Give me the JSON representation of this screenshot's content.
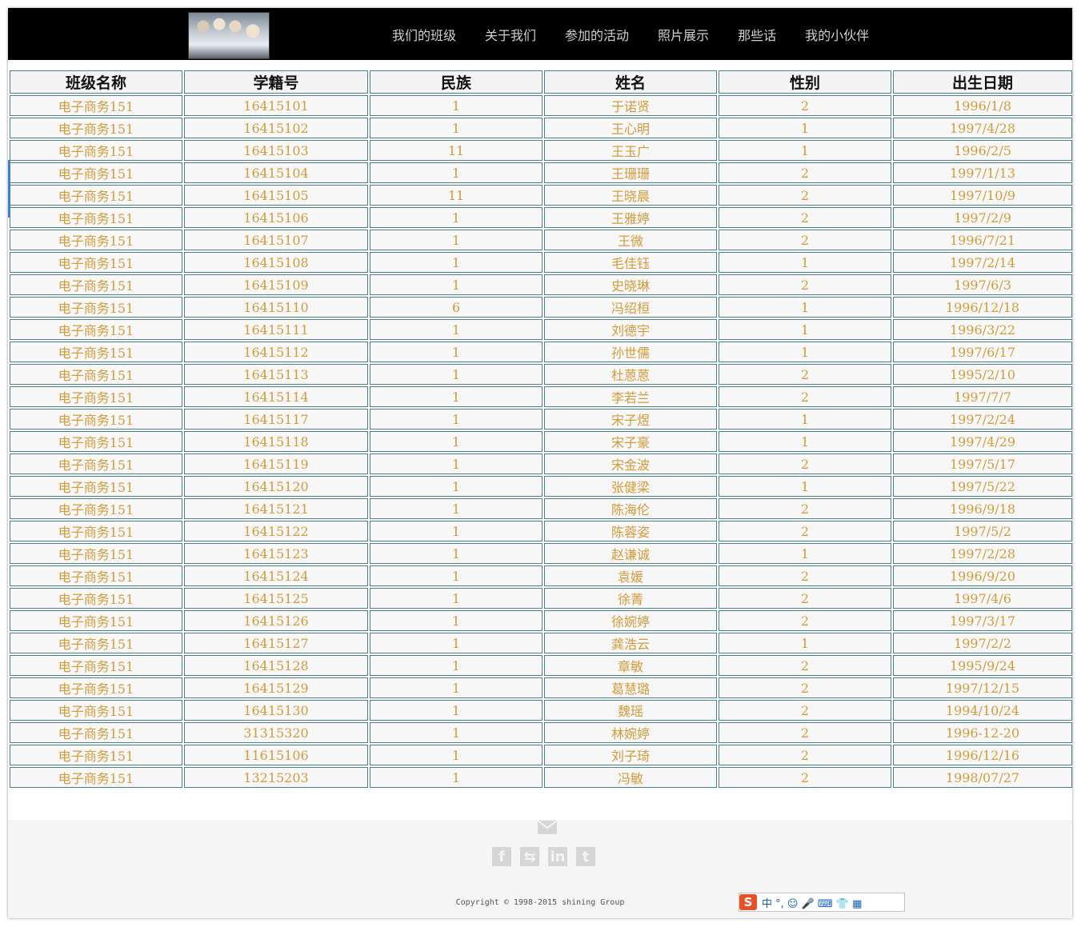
{
  "nav": {
    "items": [
      "我们的班级",
      "关于我们",
      "参加的活动",
      "照片展示",
      "那些话",
      "我的小伙伴"
    ]
  },
  "table": {
    "headers": [
      "班级名称",
      "学籍号",
      "民族",
      "姓名",
      "性别",
      "出生日期"
    ],
    "rows": [
      [
        "电子商务151",
        "16415101",
        "1",
        "于诺贤",
        "2",
        "1996/1/8"
      ],
      [
        "电子商务151",
        "16415102",
        "1",
        "王心明",
        "1",
        "1997/4/28"
      ],
      [
        "电子商务151",
        "16415103",
        "11",
        "王玉广",
        "1",
        "1996/2/5"
      ],
      [
        "电子商务151",
        "16415104",
        "1",
        "王珊珊",
        "2",
        "1997/1/13"
      ],
      [
        "电子商务151",
        "16415105",
        "11",
        "王晓晨",
        "2",
        "1997/10/9"
      ],
      [
        "电子商务151",
        "16415106",
        "1",
        "王雅婷",
        "2",
        "1997/2/9"
      ],
      [
        "电子商务151",
        "16415107",
        "1",
        "王微",
        "2",
        "1996/7/21"
      ],
      [
        "电子商务151",
        "16415108",
        "1",
        "毛佳钰",
        "1",
        "1997/2/14"
      ],
      [
        "电子商务151",
        "16415109",
        "1",
        "史晓琳",
        "2",
        "1997/6/3"
      ],
      [
        "电子商务151",
        "16415110",
        "6",
        "冯绍桓",
        "1",
        "1996/12/18"
      ],
      [
        "电子商务151",
        "16415111",
        "1",
        "刘德宇",
        "1",
        "1996/3/22"
      ],
      [
        "电子商务151",
        "16415112",
        "1",
        "孙世儒",
        "1",
        "1997/6/17"
      ],
      [
        "电子商务151",
        "16415113",
        "1",
        "杜蒽蒽",
        "2",
        "1995/2/10"
      ],
      [
        "电子商务151",
        "16415114",
        "1",
        "李若兰",
        "2",
        "1997/7/7"
      ],
      [
        "电子商务151",
        "16415117",
        "1",
        "宋子煜",
        "1",
        "1997/2/24"
      ],
      [
        "电子商务151",
        "16415118",
        "1",
        "宋子豪",
        "1",
        "1997/4/29"
      ],
      [
        "电子商务151",
        "16415119",
        "1",
        "宋金波",
        "2",
        "1997/5/17"
      ],
      [
        "电子商务151",
        "16415120",
        "1",
        "张健梁",
        "1",
        "1997/5/22"
      ],
      [
        "电子商务151",
        "16415121",
        "1",
        "陈海伦",
        "2",
        "1996/9/18"
      ],
      [
        "电子商务151",
        "16415122",
        "1",
        "陈蓉姿",
        "2",
        "1997/5/2"
      ],
      [
        "电子商务151",
        "16415123",
        "1",
        "赵谦诚",
        "1",
        "1997/2/28"
      ],
      [
        "电子商务151",
        "16415124",
        "1",
        "袁媛",
        "2",
        "1996/9/20"
      ],
      [
        "电子商务151",
        "16415125",
        "1",
        "徐菁",
        "2",
        "1997/4/6"
      ],
      [
        "电子商务151",
        "16415126",
        "1",
        "徐婉婷",
        "2",
        "1997/3/17"
      ],
      [
        "电子商务151",
        "16415127",
        "1",
        "龚浩云",
        "1",
        "1997/2/2"
      ],
      [
        "电子商务151",
        "16415128",
        "1",
        "章敏",
        "2",
        "1995/9/24"
      ],
      [
        "电子商务151",
        "16415129",
        "1",
        "葛慧璐",
        "2",
        "1997/12/15"
      ],
      [
        "电子商务151",
        "16415130",
        "1",
        "魏瑶",
        "2",
        "1994/10/24"
      ],
      [
        "电子商务151",
        "31315320",
        "1",
        "林婉婷",
        "2",
        "1996-12-20"
      ],
      [
        "电子商务151",
        "11615106",
        "1",
        "刘子琦",
        "2",
        "1996/12/16"
      ],
      [
        "电子商务151",
        "13215203",
        "1",
        "冯敏",
        "2",
        "1998/07/27"
      ]
    ]
  },
  "footer": {
    "social_icons": [
      "facebook-icon",
      "share-icon",
      "linkedin-icon",
      "tumblr-icon"
    ],
    "social_glyphs": [
      "f",
      "⇆",
      "in",
      "t"
    ],
    "copyright": "Copyright © 1998-2015 shining Group"
  },
  "ime": {
    "logo": "S",
    "label": "中 °, ☺ 🎤 ⌨ 👕 ▦"
  },
  "colors": {
    "cell_text": "#d39b3a",
    "cell_border": "#4a7f8c",
    "topbar": "#000000",
    "nav_text": "#cfcfcf"
  }
}
